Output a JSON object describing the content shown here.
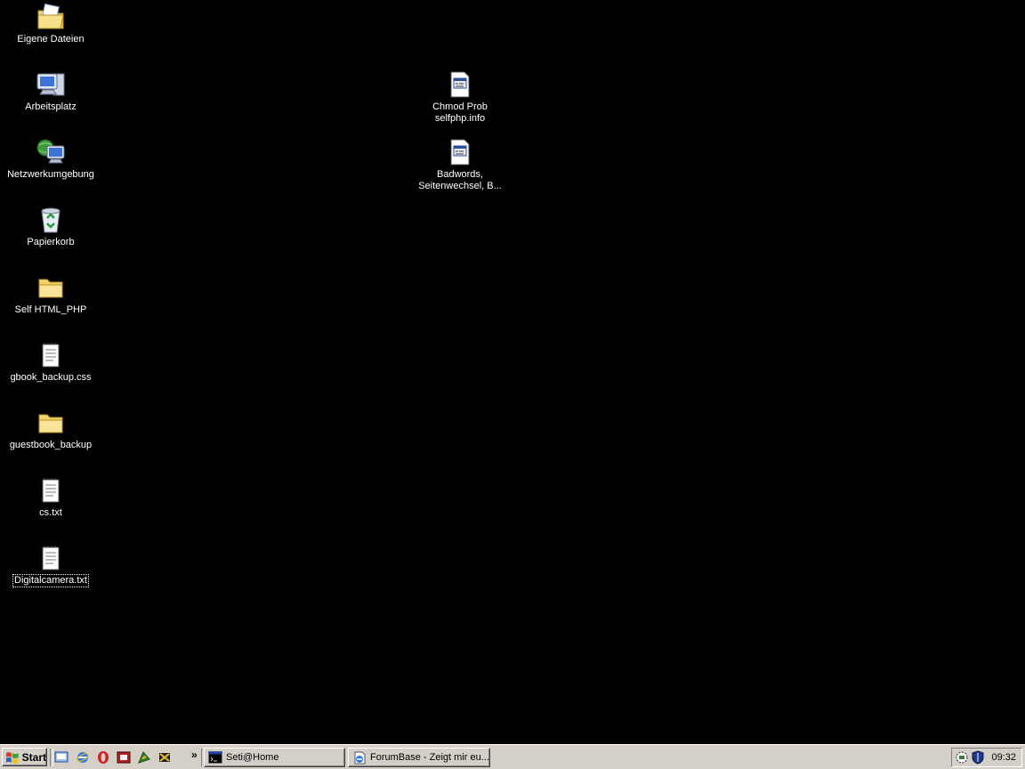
{
  "desktop": {
    "icons": [
      {
        "label": "Eigene Dateien",
        "icon": "my-documents-icon"
      },
      {
        "label": "Arbeitsplatz",
        "icon": "my-computer-icon"
      },
      {
        "label": "Netzwerkumgebung",
        "icon": "network-places-icon"
      },
      {
        "label": "Papierkorb",
        "icon": "recycle-bin-icon"
      },
      {
        "label": "Self HTML_PHP",
        "icon": "folder-icon"
      },
      {
        "label": "gbook_backup.css",
        "icon": "text-file-icon"
      },
      {
        "label": "guestbook_backup",
        "icon": "folder-icon"
      },
      {
        "label": "cs.txt",
        "icon": "text-file-icon"
      },
      {
        "label": "Digitalcamera.txt",
        "icon": "text-file-icon",
        "selected": true
      },
      {
        "label": "Chmod Prob selfphp.info",
        "line1": "Chmod Prob",
        "line2": "selfphp.info",
        "icon": "url-shortcut-icon"
      },
      {
        "label": "Badwords, Seitenwechsel, B...",
        "line1": "Badwords,",
        "line2": "Seitenwechsel, B...",
        "icon": "url-shortcut-icon"
      }
    ]
  },
  "taskbar": {
    "start_label": "Start",
    "quick_launch": [
      "show-desktop-icon",
      "internet-explorer-icon",
      "opera-icon",
      "app-icon",
      "winamp-icon",
      "tool-icon"
    ],
    "chevron": "»",
    "tasks": [
      {
        "label": "Seti@Home",
        "icon": "console-icon"
      },
      {
        "label": "ForumBase - Zeigt mir eu...",
        "icon": "internet-explorer-icon"
      }
    ],
    "tray": {
      "icons": [
        "network-tray-icon",
        "shield-tray-icon"
      ],
      "clock": "09:32"
    }
  },
  "colors": {
    "desktop_bg": "#000000",
    "taskbar_bg": "#d4d0c8"
  }
}
